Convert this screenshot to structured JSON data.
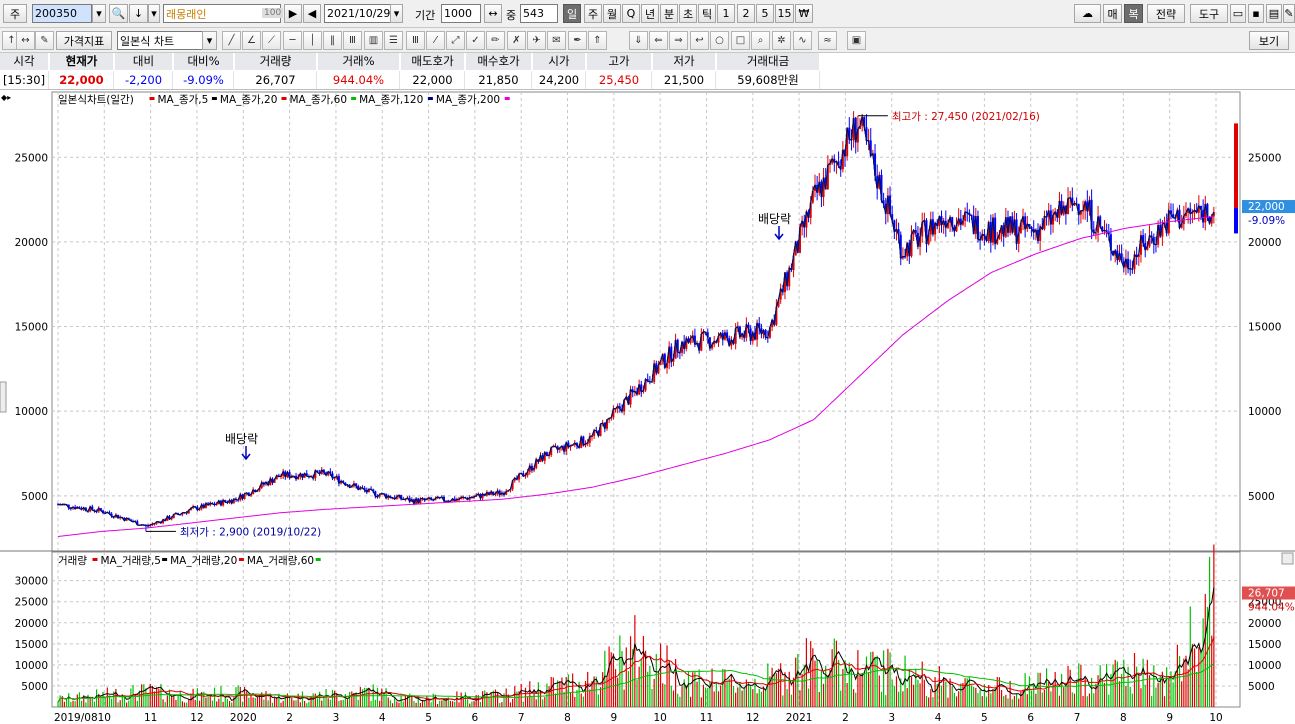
{
  "toolbar1": {
    "type_label": "주",
    "code": "200350",
    "name": "래몽래인",
    "name_badge": "100",
    "date": "2021/10/29",
    "period_label": "기간",
    "period": "1000",
    "zoom_label": "중",
    "zoom": "543",
    "tabs": [
      "일",
      "주",
      "월",
      "Q",
      "년",
      "분",
      "초",
      "틱",
      "1",
      "2",
      "5",
      "15",
      "₩"
    ],
    "right_buttons": [
      "매",
      "복",
      "전략",
      "도구"
    ]
  },
  "toolbar2": {
    "indicator_btn": "가격지표",
    "chart_type": "일본식 차트",
    "view_btn": "보기"
  },
  "quote": {
    "headers": [
      "시각",
      "현재가",
      "대비",
      "대비%",
      "거래량",
      "거래%",
      "매도호가",
      "매수호가",
      "시가",
      "고가",
      "저가",
      "거래대금"
    ],
    "values": [
      "[15:30]",
      "22,000",
      "-2,200",
      "-9.09%",
      "26,707",
      "944.04%",
      "22,000",
      "21,850",
      "24,200",
      "25,450",
      "21,500",
      "59,608만원"
    ]
  },
  "price_legend": {
    "title": "일본식차트(일간)",
    "items": [
      {
        "label": "MA_종가,5",
        "color": "#e00000"
      },
      {
        "label": "MA_종가,20",
        "color": "#000000"
      },
      {
        "label": "MA_종가,60",
        "color": "#e00000"
      },
      {
        "label": "MA_종가,120",
        "color": "#00c000"
      },
      {
        "label": "MA_종가,200",
        "color": "#000080"
      },
      {
        "label": "",
        "color": "#e000e0"
      }
    ]
  },
  "volume_legend": {
    "title": "거래량",
    "items": [
      {
        "label": "MA_거래량,5",
        "color": "#e00000"
      },
      {
        "label": "MA_거래량,20",
        "color": "#000000"
      },
      {
        "label": "MA_거래량,60",
        "color": "#e00000"
      },
      {
        "label": "",
        "color": "#00c000"
      }
    ]
  },
  "annotations": {
    "high": "최고가 : 27,450 (2021/02/16)",
    "low": "최저가 : 2,900 (2019/10/22)",
    "dividend1": "배당락",
    "dividend2": "배당락"
  },
  "price_axis": {
    "ticks": [
      5000,
      10000,
      15000,
      20000,
      25000
    ],
    "ymin": 1800,
    "ymax": 28500,
    "current_label": "22,000",
    "current_pct": "-9.09%"
  },
  "volume_axis": {
    "ticks": [
      5000,
      10000,
      15000,
      20000,
      25000,
      30000
    ],
    "ymax": 33000,
    "current_label": "26,707",
    "current_pct": "944.04%"
  },
  "x_axis": {
    "labels": [
      "2019/08",
      "10",
      "11",
      "12",
      "2020",
      "2",
      "3",
      "4",
      "5",
      "6",
      "7",
      "8",
      "9",
      "10",
      "11",
      "12",
      "2021",
      "2",
      "3",
      "4",
      "5",
      "6",
      "7",
      "8",
      "9",
      "10"
    ]
  },
  "colors": {
    "up": "#e00000",
    "down": "#0000ff",
    "ma5": "#e00000",
    "ma20": "#000000",
    "ma60": "#e00000",
    "ma120": "#00c000",
    "ma200": "#000080",
    "ma_extra": "#e000e0",
    "current_badge": "#2f8fe0",
    "volume_badge": "#e05050"
  },
  "chart_data": {
    "type": "candlestick",
    "title": "일본식차트(일간)",
    "x": [
      "2019-08",
      "2019-09",
      "2019-10",
      "2019-11",
      "2019-12",
      "2020-01",
      "2020-02",
      "2020-03",
      "2020-04",
      "2020-05",
      "2020-06",
      "2020-07",
      "2020-08",
      "2020-09",
      "2020-10",
      "2020-11",
      "2020-12",
      "2021-01",
      "2021-02",
      "2021-03",
      "2021-04",
      "2021-05",
      "2021-06",
      "2021-07",
      "2021-08",
      "2021-09",
      "2021-10"
    ],
    "series": [
      {
        "name": "종가",
        "values": [
          4500,
          4100,
          3200,
          4200,
          4800,
          6200,
          6300,
          5200,
          4700,
          4800,
          5200,
          7500,
          8400,
          11200,
          14000,
          14300,
          14800,
          22500,
          27000,
          19500,
          21600,
          20700,
          20700,
          22500,
          18700,
          21300,
          22000
        ]
      },
      {
        "name": "MA_종가,200",
        "values": [
          2600,
          2900,
          3100,
          3400,
          3700,
          4000,
          4200,
          4350,
          4500,
          4650,
          4800,
          5100,
          5500,
          6100,
          6800,
          7500,
          8300,
          9500,
          12000,
          14500,
          16500,
          18200,
          19300,
          20200,
          20800,
          21200,
          21500
        ]
      }
    ],
    "volume": [
      2000,
      3000,
      4000,
      3000,
      3500,
      2500,
      3000,
      4000,
      2000,
      2500,
      3000,
      5000,
      7000,
      15000,
      8000,
      6000,
      7000,
      12000,
      10000,
      9000,
      6000,
      5000,
      6000,
      7000,
      9000,
      7000,
      26707
    ],
    "extremes": {
      "high": 27450,
      "low": 2900
    },
    "ylim_price": [
      1800,
      28500
    ],
    "ylim_volume": [
      0,
      33000
    ]
  }
}
